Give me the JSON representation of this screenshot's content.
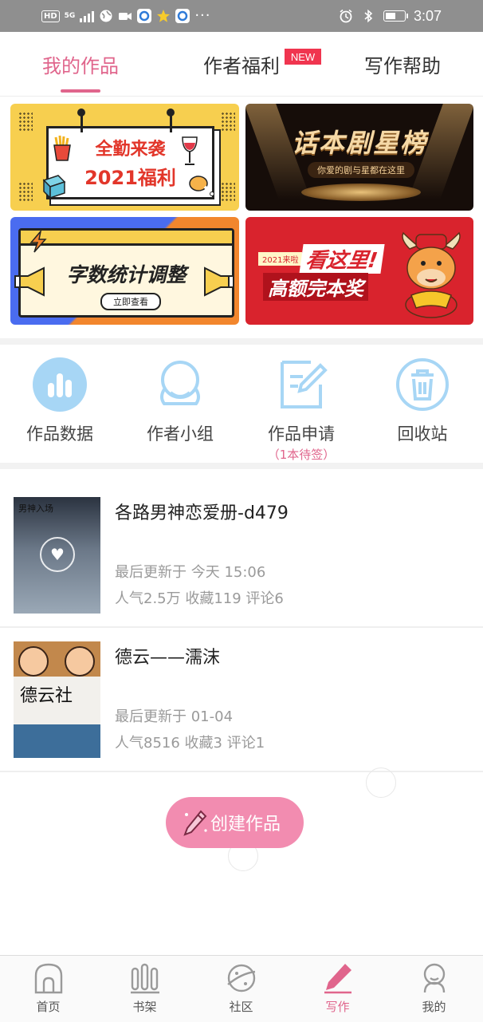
{
  "status_bar": {
    "hd": "HD",
    "signal": "5G",
    "time": "3:07",
    "more": "···"
  },
  "tabs": [
    {
      "label": "我的作品",
      "active": true
    },
    {
      "label": "作者福利",
      "badge": "NEW"
    },
    {
      "label": "写作帮助"
    }
  ],
  "banners": {
    "welfare": {
      "line1": "全勤来袭",
      "line2": "2021福利"
    },
    "ranking": {
      "title": "话本剧星榜",
      "subtitle": "你爱的剧与星都在这里"
    },
    "word_count": {
      "title": "字数统计调整",
      "button": "立即查看"
    },
    "reward": {
      "tag": "2021来啦",
      "line1": "看这里!",
      "line2": "高额完本奖"
    }
  },
  "tools": [
    {
      "label": "作品数据",
      "icon": "bar-chart-icon"
    },
    {
      "label": "作者小组",
      "icon": "group-icon"
    },
    {
      "label": "作品申请",
      "icon": "edit-document-icon",
      "sub": "（1本待签）"
    },
    {
      "label": "回收站",
      "icon": "trash-icon"
    }
  ],
  "works": [
    {
      "title": "各路男神恋爱册-d479",
      "updated": "最后更新于 今天 15:06",
      "stats": "人气2.5万 收藏119 评论6",
      "cover_text": "男神入场"
    },
    {
      "title": "德云——濡沫",
      "updated": "最后更新于 01-04",
      "stats": "人气8516 收藏3 评论1",
      "cover_text": "德云社"
    }
  ],
  "create_button": "创建作品",
  "bottom_nav": [
    {
      "label": "首页",
      "icon": "home-icon"
    },
    {
      "label": "书架",
      "icon": "bookshelf-icon"
    },
    {
      "label": "社区",
      "icon": "planet-icon"
    },
    {
      "label": "写作",
      "icon": "pencil-icon",
      "active": true
    },
    {
      "label": "我的",
      "icon": "profile-icon"
    }
  ],
  "colors": {
    "accent": "#e0658c",
    "badge": "#f0354f",
    "icon_blue": "#9fcff0",
    "create_button": "#f28cb0"
  }
}
